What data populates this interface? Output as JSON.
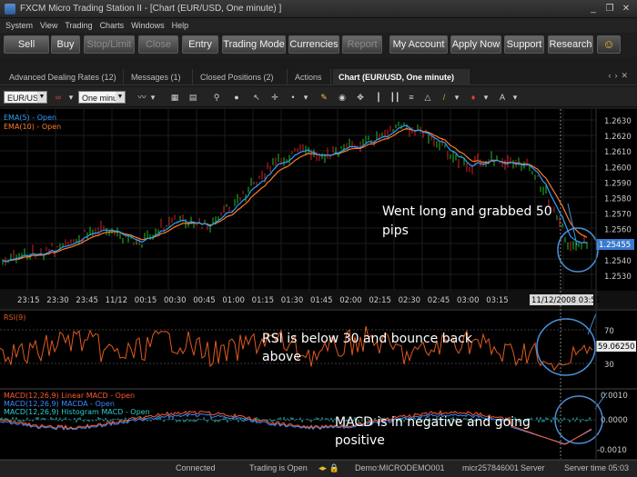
{
  "window": {
    "title": "FXCM Micro Trading Station II - [Chart (EUR/USD, One minute) ]"
  },
  "menu": [
    "System",
    "View",
    "Trading",
    "Charts",
    "Windows",
    "Help"
  ],
  "toolbar": {
    "buttons": [
      {
        "label": "Sell",
        "enabled": true
      },
      {
        "label": "Buy",
        "enabled": true
      },
      {
        "label": "Stop/Limit",
        "enabled": false
      },
      {
        "label": "Close",
        "enabled": false
      },
      {
        "label": "Entry",
        "enabled": true
      },
      {
        "label": "Trading Mode",
        "enabled": true
      },
      {
        "label": "Currencies",
        "enabled": true
      },
      {
        "label": "Report",
        "enabled": false
      },
      {
        "label": "My Account",
        "enabled": true
      },
      {
        "label": "Apply Now",
        "enabled": true
      },
      {
        "label": "Support",
        "enabled": true
      },
      {
        "label": "Research",
        "enabled": true
      }
    ]
  },
  "tabs": [
    {
      "label": "Advanced Dealing Rates (12)",
      "active": false
    },
    {
      "label": "Messages (1)",
      "active": false
    },
    {
      "label": "Closed Positions (2)",
      "active": false
    },
    {
      "label": "Actions",
      "active": false
    },
    {
      "label": "Chart (EUR/USD, One minute)",
      "active": true
    }
  ],
  "chart_toolbar": {
    "instrument": "EUR/USD",
    "timeframe": "One minute"
  },
  "chart": {
    "price_legend": [
      "EMA(5) - Open",
      "EMA(10) - Open"
    ],
    "price_axis": [
      "1.2630",
      "1.2620",
      "1.2610",
      "1.2600",
      "1.2590",
      "1.2580",
      "1.2570",
      "1.2560",
      "1.2550",
      "1.2540",
      "1.2530"
    ],
    "current_price": "1.25455",
    "time_axis": [
      "23:15",
      "23:30",
      "23:45",
      "11/12",
      "00:15",
      "00:30",
      "00:45",
      "01:00",
      "01:15",
      "01:30",
      "01:45",
      "02:00",
      "02:15",
      "02:30",
      "02:45",
      "03:00",
      "03:15"
    ],
    "cursor_time": "11/12/2008 03:51",
    "rsi_label": "RSI(9)",
    "rsi_axis": [
      "70",
      "30"
    ],
    "rsi_value": "59.06250",
    "macd_legend": [
      "MACD(12,26,9) Linear MACD - Open",
      "MACD(12,26,9) MACDA - Open",
      "MACD(12,26,9) Histogram MACD - Open"
    ],
    "macd_axis": [
      "0.0010",
      "0.0000",
      "-0.0010"
    ],
    "annotations": {
      "price": [
        "Went long  and grabbed  50",
        "pips"
      ],
      "rsi": [
        "RSI is below 30 and bounce back",
        "above"
      ],
      "macd": [
        "MACD is in negative and going",
        "positive"
      ]
    },
    "colors": {
      "ema5": "#2aa0ff",
      "ema10": "#ff7a2a",
      "bull": "#22c022",
      "bear": "#d82020",
      "rsi": "#e05a20",
      "macd_linear": "#ff5a2a",
      "macda": "#3a8aff",
      "histogram": "#2ad0d0",
      "circle": "#4a90d9"
    }
  },
  "status": {
    "connection": "Connected",
    "trading": "Trading is Open",
    "account": "Demo:MICRODEMO001",
    "user": "micr257846001",
    "server": "Server",
    "server_time": "Server time 05:03"
  }
}
